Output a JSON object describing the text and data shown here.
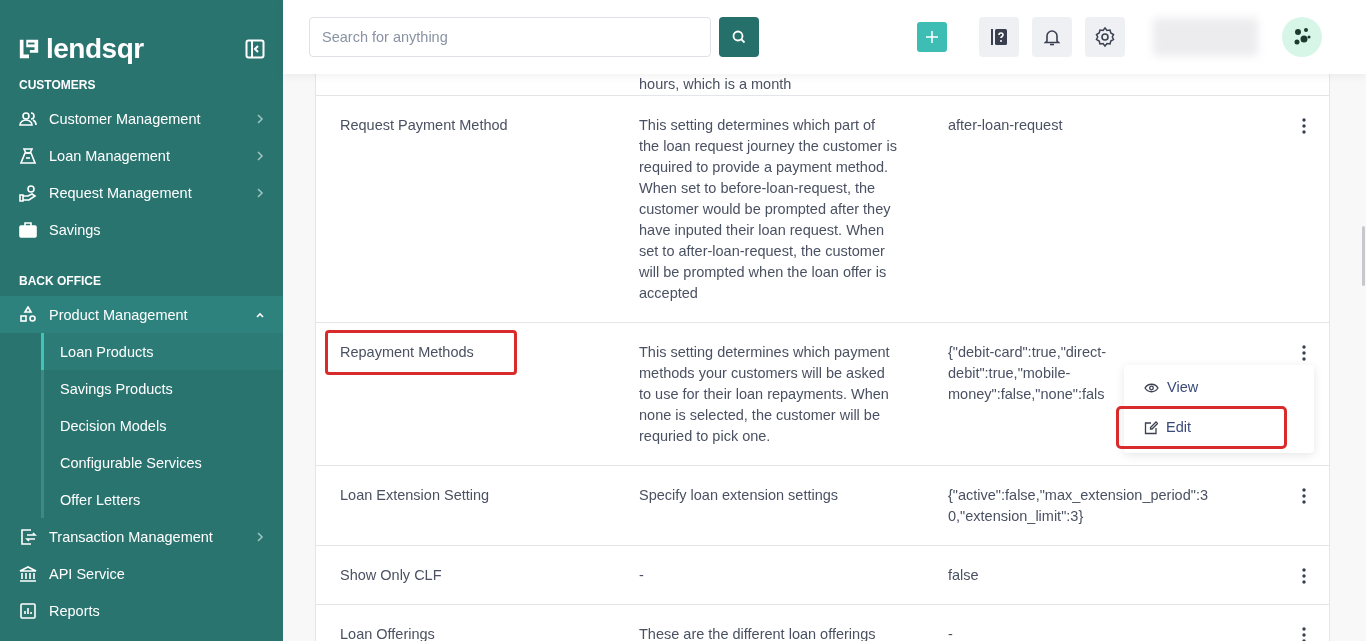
{
  "sidebar": {
    "brand": "lendsqr",
    "sections": [
      {
        "heading": "CUSTOMERS",
        "items": [
          {
            "label": "Customer Management",
            "kind": "group",
            "expanded": false
          },
          {
            "label": "Loan Management",
            "kind": "group",
            "expanded": false
          },
          {
            "label": "Request Management",
            "kind": "group",
            "expanded": false
          },
          {
            "label": "Savings",
            "kind": "link",
            "expanded": false
          }
        ]
      },
      {
        "heading": "BACK OFFICE",
        "items": [
          {
            "label": "Product Management",
            "kind": "group",
            "expanded": true,
            "children": [
              {
                "label": "Loan Products",
                "selected": true
              },
              {
                "label": "Savings Products",
                "selected": false
              },
              {
                "label": "Decision Models",
                "selected": false
              },
              {
                "label": "Configurable Services",
                "selected": false
              },
              {
                "label": "Offer Letters",
                "selected": false
              }
            ]
          },
          {
            "label": "Transaction Management",
            "kind": "group",
            "expanded": false
          },
          {
            "label": "API Service",
            "kind": "link",
            "expanded": false
          },
          {
            "label": "Reports",
            "kind": "link",
            "expanded": false
          }
        ]
      }
    ]
  },
  "topbar": {
    "search": {
      "placeholder": "Search for anything"
    }
  },
  "table": {
    "partial_description": "hours, which is a month",
    "rows": [
      {
        "name": "Request Payment Method",
        "description": "This setting determines which part of the loan request journey the customer is required to provide a payment method. When set to before-loan-request, the customer would be prompted after they have inputed their loan request. When set to after-loan-request, the customer will be prompted when the loan offer is accepted",
        "value": "after-loan-request",
        "annotated": false
      },
      {
        "name": "Repayment Methods",
        "description": "This setting determines which payment methods your customers will be asked to use for their loan repayments. When none is selected, the customer will be requried to pick one.",
        "value": "{\"debit-card\":true,\"direct-debit\":true,\"mobile-money\":false,\"none\":fals",
        "annotated": true,
        "menu": [
          {
            "label": "View",
            "annotated": false
          },
          {
            "label": "Edit",
            "annotated": true
          }
        ]
      },
      {
        "name": "Loan Extension Setting",
        "description": "Specify loan extension settings",
        "value": "{\"active\":false,\"max_extension_period\":30,\"extension_limit\":3}",
        "annotated": false
      },
      {
        "name": "Show Only CLF",
        "description": "-",
        "value": "false",
        "annotated": false
      },
      {
        "name": "Loan Offerings",
        "description": "These are the different loan offerings",
        "value": "-",
        "annotated": false
      }
    ]
  }
}
